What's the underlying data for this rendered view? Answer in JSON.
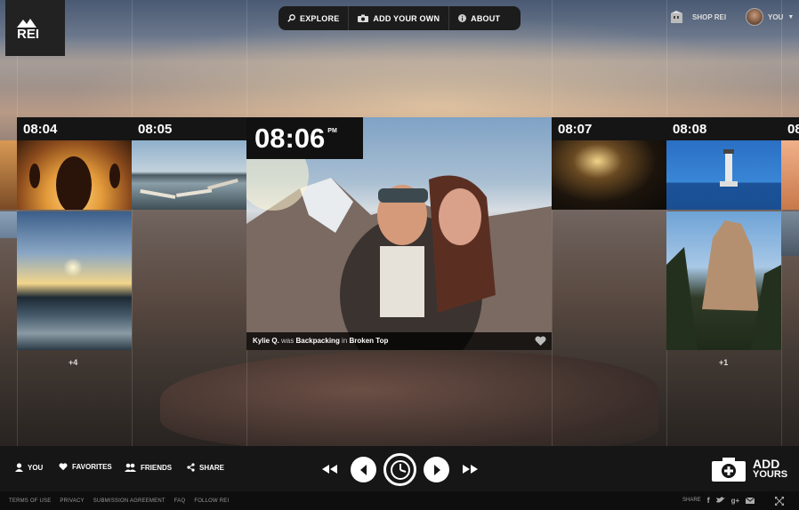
{
  "nav": {
    "explore": "EXPLORE",
    "add": "ADD YOUR OWN",
    "about": "ABOUT"
  },
  "header": {
    "shop": "SHOP REI",
    "you": "YOU"
  },
  "logo": {
    "text": "REI"
  },
  "timeline": {
    "t1": "08:04",
    "t2": "08:05",
    "t3": "08:07",
    "t4": "08:08",
    "t5": "08",
    "more_left": "+4",
    "more_right": "+1"
  },
  "feature": {
    "time": "08:06",
    "ampm": "PM",
    "user": "Kylie Q.",
    "was": " was ",
    "activity": "Backpacking",
    "in": " in ",
    "place": "Broken Top"
  },
  "bottom": {
    "you": "YOU",
    "favorites": "FAVORITES",
    "friends": "FRIENDS",
    "share": "SHARE",
    "add1": "ADD",
    "add2": "YOURS"
  },
  "footer": {
    "terms": "TERMS OF USE",
    "privacy": "PRIVACY",
    "submission": "SUBMISSION AGREEMENT",
    "faq": "FAQ",
    "follow": "FOLLOW REI",
    "share": "SHARE"
  }
}
